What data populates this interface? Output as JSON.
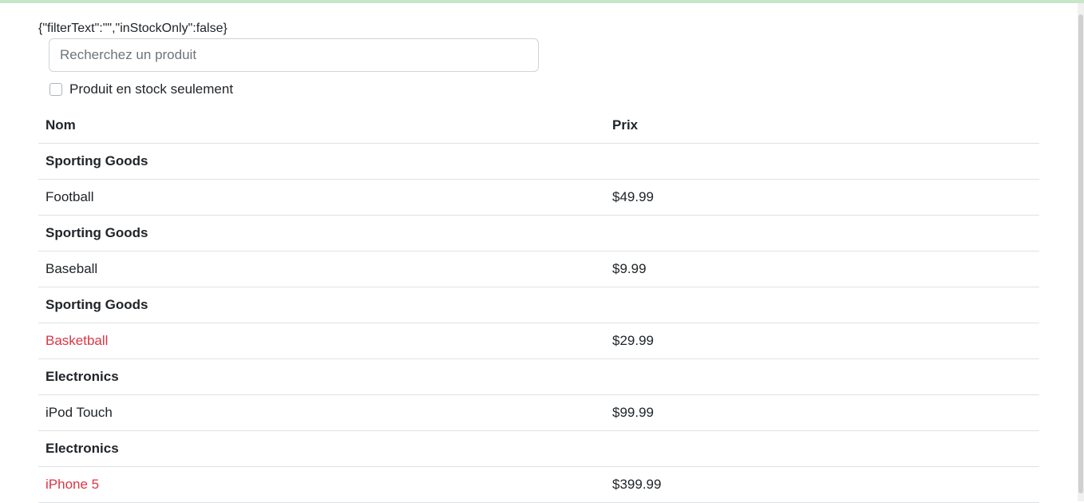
{
  "state_json": "{\"filterText\":\"\",\"inStockOnly\":false}",
  "search": {
    "placeholder": "Recherchez un produit",
    "value": ""
  },
  "stock_filter": {
    "label": "Produit en stock seulement",
    "checked": false
  },
  "table": {
    "headers": {
      "name": "Nom",
      "price": "Prix"
    },
    "rows": [
      {
        "type": "category",
        "name": "Sporting Goods"
      },
      {
        "type": "product",
        "name": "Football",
        "price": "$49.99",
        "stocked": true
      },
      {
        "type": "category",
        "name": "Sporting Goods"
      },
      {
        "type": "product",
        "name": "Baseball",
        "price": "$9.99",
        "stocked": true
      },
      {
        "type": "category",
        "name": "Sporting Goods"
      },
      {
        "type": "product",
        "name": "Basketball",
        "price": "$29.99",
        "stocked": false
      },
      {
        "type": "category",
        "name": "Electronics"
      },
      {
        "type": "product",
        "name": "iPod Touch",
        "price": "$99.99",
        "stocked": true
      },
      {
        "type": "category",
        "name": "Electronics"
      },
      {
        "type": "product",
        "name": "iPhone 5",
        "price": "$399.99",
        "stocked": false
      }
    ]
  },
  "colors": {
    "out_of_stock": "#dc3545",
    "top_strip": "#c8e6c9"
  }
}
